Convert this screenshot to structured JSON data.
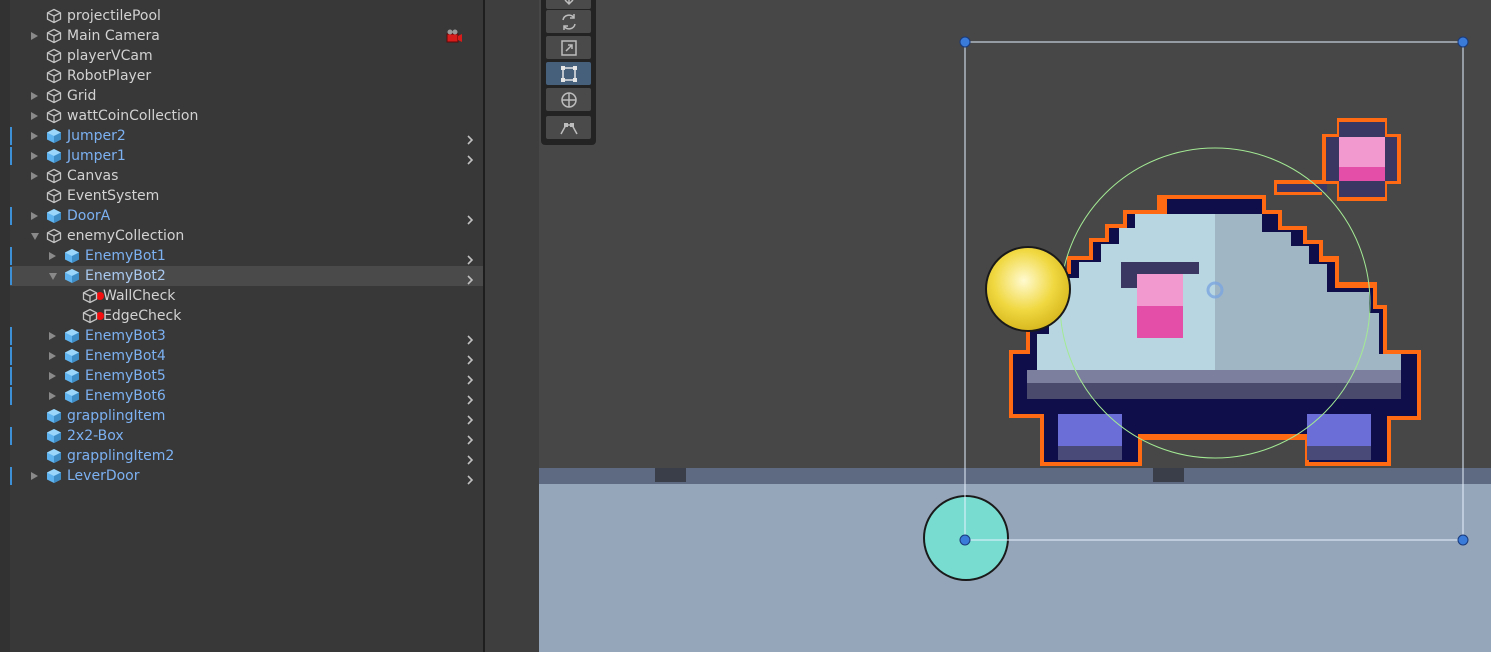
{
  "hierarchy": {
    "items": [
      {
        "label": "projectilePool",
        "foldout": "none",
        "prefab": false
      },
      {
        "label": "Main Camera",
        "foldout": "closed",
        "prefab": false
      },
      {
        "label": "playerVCam",
        "foldout": "none",
        "prefab": false
      },
      {
        "label": "RobotPlayer",
        "foldout": "none",
        "prefab": false
      },
      {
        "label": "Grid",
        "foldout": "closed",
        "prefab": false
      },
      {
        "label": "wattCoinCollection",
        "foldout": "closed",
        "prefab": false
      },
      {
        "label": "Jumper2",
        "foldout": "closed",
        "prefab": true
      },
      {
        "label": "Jumper1",
        "foldout": "closed",
        "prefab": true
      },
      {
        "label": "Canvas",
        "foldout": "closed",
        "prefab": false
      },
      {
        "label": "EventSystem",
        "foldout": "none",
        "prefab": false
      },
      {
        "label": "DoorA",
        "foldout": "closed",
        "prefab": true
      },
      {
        "label": "enemyCollection",
        "foldout": "open",
        "prefab": false
      },
      {
        "label": "EnemyBot1",
        "foldout": "closed",
        "prefab": true
      },
      {
        "label": "EnemyBot2",
        "foldout": "open",
        "prefab": true,
        "selected": true
      },
      {
        "label": "WallCheck",
        "foldout": "none",
        "prefab": false,
        "added": true
      },
      {
        "label": "EdgeCheck",
        "foldout": "none",
        "prefab": false,
        "added": true
      },
      {
        "label": "EnemyBot3",
        "foldout": "closed",
        "prefab": true
      },
      {
        "label": "EnemyBot4",
        "foldout": "closed",
        "prefab": true
      },
      {
        "label": "EnemyBot5",
        "foldout": "closed",
        "prefab": true
      },
      {
        "label": "EnemyBot6",
        "foldout": "closed",
        "prefab": true
      },
      {
        "label": "grapplingItem",
        "foldout": "none",
        "prefab": true
      },
      {
        "label": "2x2-Box",
        "foldout": "none",
        "prefab": true
      },
      {
        "label": "grapplingItem2",
        "foldout": "none",
        "prefab": true
      },
      {
        "label": "LeverDoor",
        "foldout": "closed",
        "prefab": true
      }
    ]
  },
  "toolbar": {
    "tools": [
      {
        "name": "move-tool-icon",
        "active": false
      },
      {
        "name": "rotate-tool-icon",
        "active": false
      },
      {
        "name": "scale-tool-icon",
        "active": false
      },
      {
        "name": "rect-tool-icon",
        "active": true
      },
      {
        "name": "transform-tool-icon",
        "active": false
      },
      {
        "name": "custom-editor-tool-icon",
        "active": false
      }
    ]
  },
  "colors": {
    "prefab_text": "#7cb1f2",
    "override_bar": "#3d8fd6",
    "selection_outline": "#ff6a13",
    "scene_background": "#474747",
    "ground": "#96a6ba"
  }
}
